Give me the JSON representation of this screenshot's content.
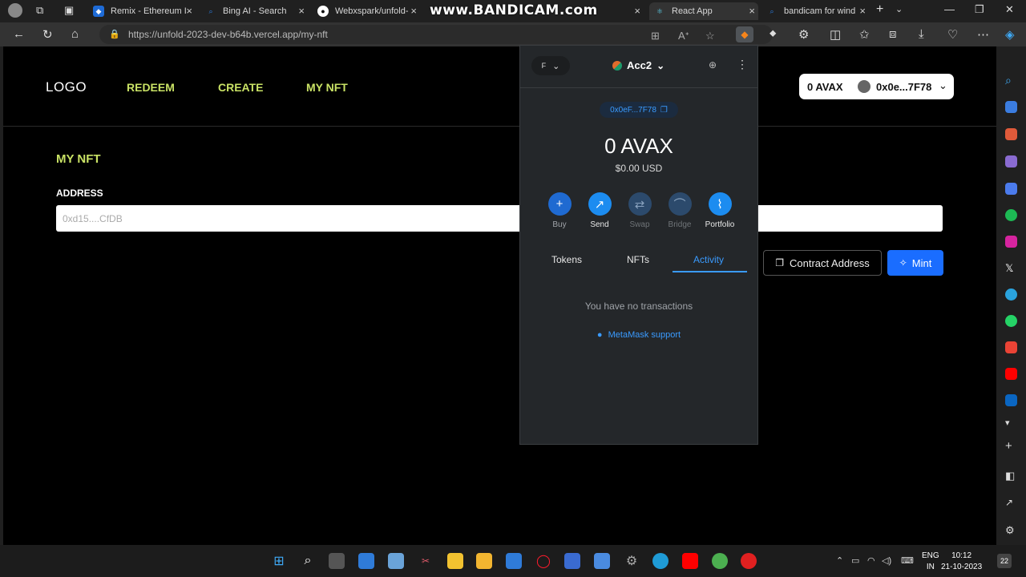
{
  "browser": {
    "tabs": [
      {
        "title": "Remix - Ethereum I",
        "color": "#1e6bd6"
      },
      {
        "title": "Bing AI - Search",
        "color": "#2a7de1"
      },
      {
        "title": "Webxspark/unfold-",
        "color": "#ffffff"
      },
      {
        "title": "",
        "color": "#444444"
      },
      {
        "title": "React App",
        "color": "#5fd4f0"
      },
      {
        "title": "bandicam for wind",
        "color": "#2a7de1"
      }
    ],
    "watermark": "www.BANDICAM.com",
    "url": "https://unfold-2023-dev-b64b.vercel.app/my-nft"
  },
  "site": {
    "logo": "LOGO",
    "nav": [
      "REDEEM",
      "CREATE",
      "MY NFT"
    ],
    "wallet_balance": "0 AVAX",
    "wallet_address": "0x0e...7F78",
    "page_title": "MY NFT",
    "address_label": "ADDRESS",
    "address_placeholder": "0xd15....CfDB",
    "contract_button": "Contract Address",
    "mint_button": "Mint",
    "accent": "#c9e265",
    "button_blue": "#1a6dff"
  },
  "metamask": {
    "network": "F",
    "account": "Acc2",
    "address": "0x0eF...7F78",
    "balance": "0 AVAX",
    "usd": "$0.00 USD",
    "actions": [
      {
        "label": "Buy",
        "icon": "+",
        "enabled": true
      },
      {
        "label": "Send",
        "icon": "↗",
        "enabled": true
      },
      {
        "label": "Swap",
        "icon": "⇄",
        "enabled": false
      },
      {
        "label": "Bridge",
        "icon": "⌒",
        "enabled": false
      },
      {
        "label": "Portfolio",
        "icon": "⌇",
        "enabled": true
      }
    ],
    "tabs": [
      "Tokens",
      "NFTs",
      "Activity"
    ],
    "active_tab": "Activity",
    "empty_text": "You have no transactions",
    "support_link": "MetaMask support",
    "accent": "#3a9bff"
  },
  "taskbar": {
    "lang_top": "ENG",
    "lang_bottom": "IN",
    "time": "10:12",
    "date": "21-10-2023",
    "notifications": "22"
  }
}
